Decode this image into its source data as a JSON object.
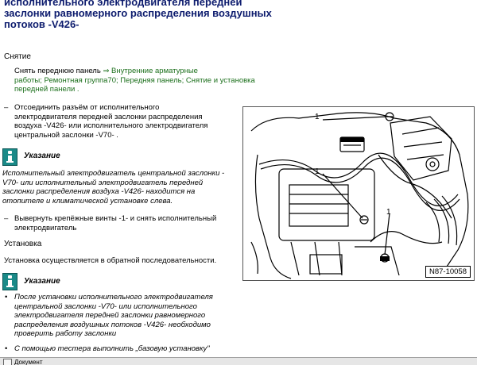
{
  "title": {
    "line1": "исполнительного электродвигателя передней",
    "line2": "заслонки равномерного распределения воздушных",
    "line3": "потоков -V426-"
  },
  "removal": {
    "label": "Снятие",
    "step1": {
      "line1_text": "Снять переднюю панель ",
      "line1_link": "⇒ Внутренние арматурные",
      "line2": "работы; Ремонтная группа70; Передняя панель; Снятие и установка",
      "line3": "передней панели ."
    },
    "step2": {
      "dash": "–",
      "line1": "Отсоединить разъём от исполнительного",
      "line2": "электродвигателя передней заслонки распределения",
      "line3": "воздуха -V426- или исполнительного электродвигателя",
      "line4": "центральной заслонки -V70- ."
    },
    "note": {
      "title": "Указание",
      "line1": "Исполнительный электродвигатель центральной заслонки -",
      "line2": "V70- или исполнительный электродвигатель передней",
      "line3": "заслонки распределения воздуха -V426- находится на",
      "line4": "отопителе и климатической установке слева."
    },
    "step3": {
      "dash": "–",
      "line1": "Вывернуть крепёжные винты -1- и снять исполнительный",
      "line2": "электродвигатель"
    }
  },
  "install": {
    "label": "Установка",
    "text": "Установка осуществляется в обратной последовательности.",
    "note": {
      "title": "Указание",
      "bullet": "•",
      "line1": "После установки исполнительного электродвигателя",
      "line2": "центральной заслонки -V70- или исполнительного",
      "line3": "электродвигателя передней заслонки равномерного",
      "line4": "распределения воздушных потоков -V426- необходимо",
      "line5": "проверить работу заслонки",
      "last": "С помощью тестера выполнить „базовую установку\""
    }
  },
  "figure": {
    "code": "N87-10058",
    "callouts": [
      "1",
      "1",
      "1"
    ]
  },
  "bottom": {
    "tab_label": "Документ"
  },
  "colors": {
    "title": "#0d1c6e",
    "link": "#1b6f1b",
    "note_icon": "#1a8a88"
  },
  "icons": {
    "note": "info-icon"
  }
}
